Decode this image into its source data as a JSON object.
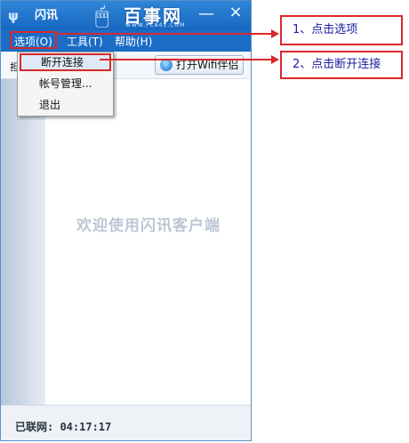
{
  "window": {
    "title": "闪讯",
    "logo_icon": "ψ",
    "watermark": {
      "icon": "mouse-icon",
      "text": "百事网",
      "url": "WWW.PC841.COM"
    },
    "minimize_glyph": "—",
    "close_glyph": "×"
  },
  "menu": {
    "items": [
      {
        "label": "选项(O)"
      },
      {
        "label": "工具(T)"
      },
      {
        "label": "帮助(H)"
      }
    ]
  },
  "toolbar": {
    "status_partial": "担                 ifi!",
    "wifi_button_label": "打开Wifi伴侣",
    "wifi_icon": "wifi-icon"
  },
  "dropdown": {
    "items": [
      {
        "label": "断开连接"
      },
      {
        "label": "帐号管理..."
      },
      {
        "label": "退出"
      }
    ]
  },
  "main": {
    "welcome": "欢迎使用闪讯客户端"
  },
  "footer": {
    "connected": "已联网: 04:17:17"
  },
  "annotations": {
    "step1": "1、点击选项",
    "step2": "2、点击断开连接"
  },
  "colors": {
    "titlebar": "#1767c0",
    "highlight_red": "#d9282b",
    "callout_text": "#1a1aa0"
  }
}
